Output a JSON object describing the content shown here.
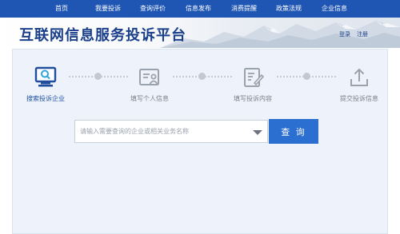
{
  "nav": {
    "items": [
      "首页",
      "我要投诉",
      "查询评价",
      "信息发布",
      "消费提醒",
      "政策法规",
      "企业信息"
    ]
  },
  "header": {
    "title": "互联网信息服务投诉平台",
    "login": "登录",
    "register": "注册"
  },
  "steps": [
    {
      "label": "搜索投诉企业",
      "icon": "monitor-search-icon",
      "state": "active"
    },
    {
      "label": "填写个人信息",
      "icon": "id-card-icon",
      "state": "pending"
    },
    {
      "label": "填写投诉内容",
      "icon": "document-edit-icon",
      "state": "pending"
    },
    {
      "label": "提交投诉信息",
      "icon": "upload-icon",
      "state": "pending"
    }
  ],
  "search": {
    "placeholder": "请输入需要查询的企业或相关业务名称",
    "button_label": "查 询"
  },
  "colors": {
    "nav_bg": "#1f56b3",
    "title": "#1a3f8a",
    "accent": "#2b6fd0",
    "panel_bg": "#eef3fb"
  }
}
